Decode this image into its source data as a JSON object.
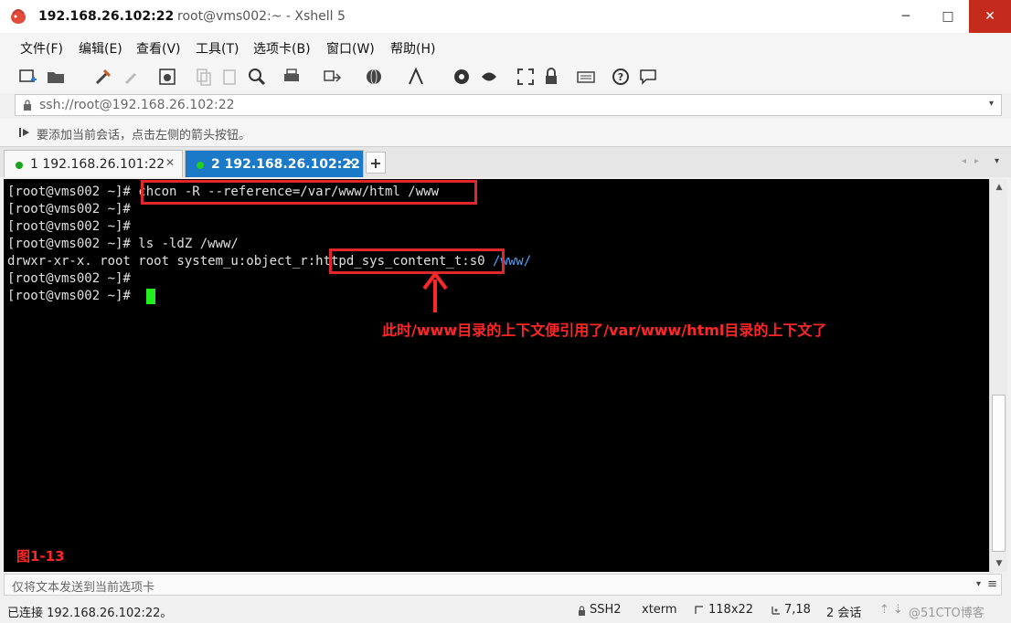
{
  "window": {
    "title": "192.168.26.102:22",
    "subtitle": "root@vms002:~ - Xshell 5",
    "minimize": "─",
    "maximize": "□",
    "close": "✕"
  },
  "menu": [
    "文件(F)",
    "编辑(E)",
    "查看(V)",
    "工具(T)",
    "选项卡(B)",
    "窗口(W)",
    "帮助(H)"
  ],
  "address": {
    "value": "ssh://root@192.168.26.102:22",
    "dropdown": "▾"
  },
  "hint": "要添加当前会话，点击左侧的箭头按钮。",
  "tabs": [
    {
      "label": "1 192.168.26.101:22",
      "close": "✕",
      "active": false
    },
    {
      "label": "2 192.168.26.102:22",
      "close": "✕",
      "active": true
    }
  ],
  "tab_add": "+",
  "tab_nav": {
    "prev": "◂",
    "next": "▸",
    "menu": "▾"
  },
  "terminal": {
    "lines": [
      {
        "prompt": "[root@vms002 ~]#",
        "cmd": " chcon -R --reference=/var/www/html /www"
      },
      {
        "prompt": "[root@vms002 ~]#",
        "cmd": ""
      },
      {
        "prompt": "[root@vms002 ~]#",
        "cmd": ""
      },
      {
        "prompt": "[root@vms002 ~]#",
        "cmd": " ls -ldZ /www/"
      },
      {
        "prefix": "drwxr-xr-x. root root system_u:object_r:httpd_sys_content_t:s0 ",
        "dir": "/www/"
      },
      {
        "prompt": "[root@vms002 ~]#",
        "cmd": ""
      },
      {
        "prompt": "[root@vms002 ~]#",
        "cmd": " "
      }
    ],
    "annotation": "此时/www目录的上下文便引用了/var/www/html目录的上下文了",
    "figure_label": "图1-13"
  },
  "compose": {
    "placeholder": "仅将文本发送到当前选项卡",
    "dropdown": "▾",
    "menu": "≡"
  },
  "status": {
    "connection": "已连接 192.168.26.102:22。",
    "protocol": "SSH2",
    "term": "xterm",
    "size": "118x22",
    "cursor": "7,18",
    "sessions": "2 会话",
    "arrows": "⇡ ⇣",
    "watermark": "@51CTO博客"
  },
  "colors": {
    "accent_tab": "#1a7ac8",
    "highlight": "#e0272b",
    "cursor": "#22ee22",
    "dir": "#4fa3ff"
  }
}
